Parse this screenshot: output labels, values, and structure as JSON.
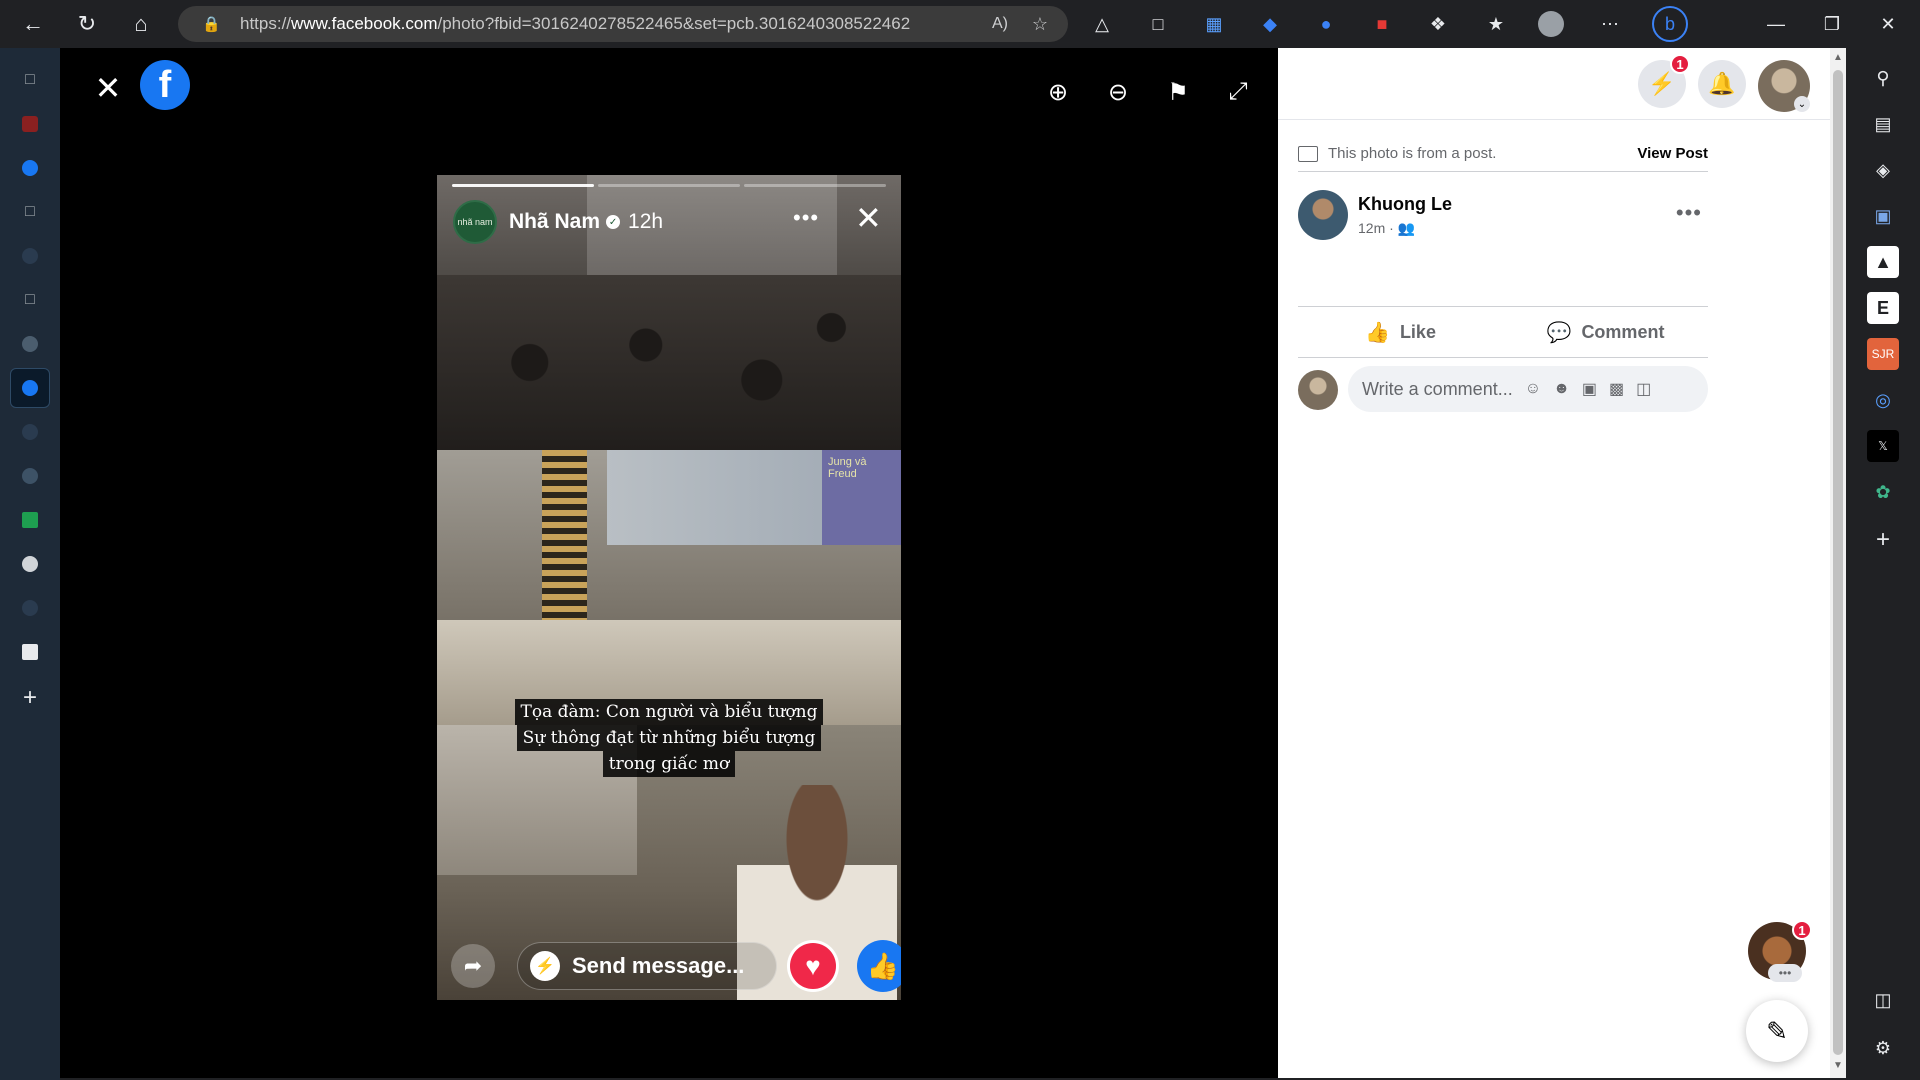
{
  "browser": {
    "url_prefix": "https://",
    "url_domain": "www.facebook.com",
    "url_path": "/photo?fbid=3016240278522465&set=pcb.3016240308522462",
    "read_aloud": "A)",
    "nav": {
      "back": "←",
      "refresh": "↻",
      "home": "⌂"
    }
  },
  "viewer": {
    "close": "✕",
    "logo": "f",
    "tools": [
      "zoom-in",
      "zoom-out",
      "tag",
      "fullscreen"
    ]
  },
  "story": {
    "author": "Nhã Nam",
    "avatar_text": "nhã nam",
    "time": "12h",
    "slide_text": "Jung và Freud",
    "caption_lines": [
      "Tọa đàm: Con người và biểu tượng",
      "Sự thông đạt từ những biểu tượng",
      "trong giấc mơ"
    ],
    "send_message": "Send message..."
  },
  "panel": {
    "messenger_badge": "1",
    "info_text": "This photo is from a post.",
    "view_post": "View Post",
    "author_name": "Khuong Le",
    "author_meta": "12m ·",
    "like": "Like",
    "comment": "Comment",
    "comment_placeholder": "Write a comment...",
    "chat_badge": "1"
  }
}
